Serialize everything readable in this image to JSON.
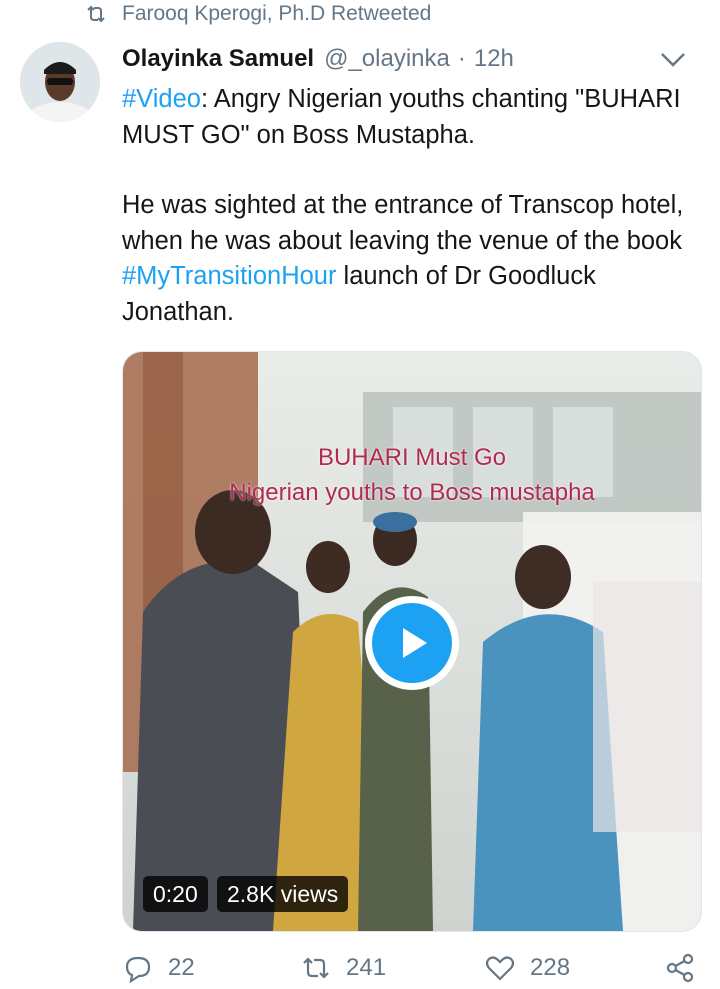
{
  "retweet": {
    "text": "Farooq Kperogi, Ph.D Retweeted",
    "icon": "retweet-icon"
  },
  "author": {
    "name": "Olayinka Samuel",
    "handle": "@_olayinka",
    "separator": "·",
    "time": "12h"
  },
  "tweet": {
    "hashtag1": "#Video",
    "line1_rest": ": Angry Nigerian youths chanting \"BUHARI MUST GO\" on Boss Mustapha.",
    "p2_before": " He was sighted at the entrance of Transcop hotel, when he was about leaving the venue of the book ",
    "hashtag2": "#MyTransitionHour",
    "p2_after": " launch of Dr Goodluck Jonathan."
  },
  "media": {
    "overlay_line1": "BUHARI Must Go",
    "overlay_line2": "Nigerian youths to Boss mustapha",
    "duration": "0:20",
    "views": "2.8K views",
    "play_icon": "play-icon"
  },
  "actions": {
    "replies": "22",
    "retweets": "241",
    "likes": "228"
  },
  "colors": {
    "link": "#1da1f2",
    "muted": "#657786",
    "text": "#14171a",
    "overlay_text": "#b02a52"
  }
}
